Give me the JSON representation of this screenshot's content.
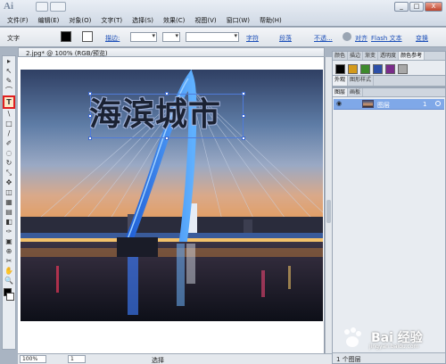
{
  "app": {
    "logo": "Ai"
  },
  "menu": [
    "文件(F)",
    "编辑(E)",
    "对象(O)",
    "文字(T)",
    "选择(S)",
    "效果(C)",
    "视图(V)",
    "窗口(W)",
    "帮助(H)"
  ],
  "window_buttons": {
    "minimize": "_",
    "restore": "□",
    "close": "X"
  },
  "control_bar": {
    "type_label": "文字",
    "stroke_label": "描边:",
    "char_link": "字符",
    "para_link": "段落",
    "opacity_label": "不透...",
    "align_link": "对齐",
    "flash_text": "Flash 文本",
    "transform_link": "变换"
  },
  "document": {
    "tab_title": "2.jpg* @ 100% (RGB/预览)",
    "headline_text": "海滨城市"
  },
  "tools": [
    "▸",
    "↖",
    "✎",
    "⌒",
    "T",
    "\\",
    "□",
    "/",
    "✐",
    "◌",
    "↻",
    "⤡",
    "✥",
    "◫",
    "▦",
    "▤",
    "◧",
    "✑",
    "▣",
    "⊕",
    "✂",
    "✋",
    "🔍"
  ],
  "status_bar": {
    "zoom": "100%",
    "page": "1",
    "mode": "选择"
  },
  "panels": {
    "swatch_tabs": [
      "颜色",
      "描边",
      "渐变",
      "透明度",
      "颜色参考"
    ],
    "appearance_tabs": [
      "外观",
      "图形样式"
    ],
    "layer_tabs": [
      "图层",
      "画板"
    ],
    "layer": {
      "name": "图层",
      "number": "1"
    },
    "layer_count": "1 个图层"
  },
  "watermark": {
    "text": "Bai 经验",
    "sub": "jingyan.baidu.com"
  },
  "colors": {
    "accent": "#7fa8e8",
    "selected_tool_border": "#e01f1f"
  }
}
